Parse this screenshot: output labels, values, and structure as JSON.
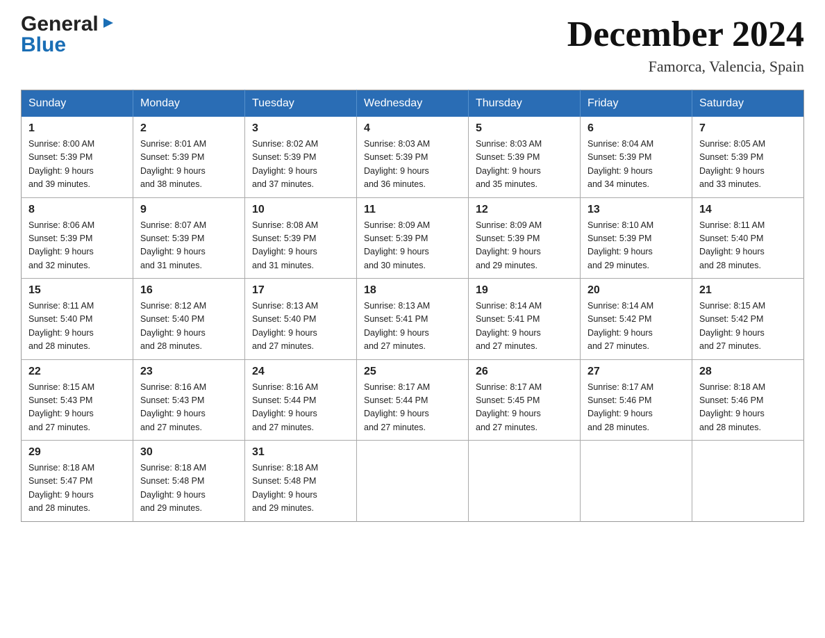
{
  "header": {
    "logo": {
      "general": "General",
      "blue": "Blue"
    },
    "title": "December 2024",
    "location": "Famorca, Valencia, Spain"
  },
  "calendar": {
    "days_of_week": [
      "Sunday",
      "Monday",
      "Tuesday",
      "Wednesday",
      "Thursday",
      "Friday",
      "Saturday"
    ],
    "weeks": [
      [
        {
          "day": 1,
          "sunrise": "8:00 AM",
          "sunset": "5:39 PM",
          "daylight": "9 hours and 39 minutes."
        },
        {
          "day": 2,
          "sunrise": "8:01 AM",
          "sunset": "5:39 PM",
          "daylight": "9 hours and 38 minutes."
        },
        {
          "day": 3,
          "sunrise": "8:02 AM",
          "sunset": "5:39 PM",
          "daylight": "9 hours and 37 minutes."
        },
        {
          "day": 4,
          "sunrise": "8:03 AM",
          "sunset": "5:39 PM",
          "daylight": "9 hours and 36 minutes."
        },
        {
          "day": 5,
          "sunrise": "8:03 AM",
          "sunset": "5:39 PM",
          "daylight": "9 hours and 35 minutes."
        },
        {
          "day": 6,
          "sunrise": "8:04 AM",
          "sunset": "5:39 PM",
          "daylight": "9 hours and 34 minutes."
        },
        {
          "day": 7,
          "sunrise": "8:05 AM",
          "sunset": "5:39 PM",
          "daylight": "9 hours and 33 minutes."
        }
      ],
      [
        {
          "day": 8,
          "sunrise": "8:06 AM",
          "sunset": "5:39 PM",
          "daylight": "9 hours and 32 minutes."
        },
        {
          "day": 9,
          "sunrise": "8:07 AM",
          "sunset": "5:39 PM",
          "daylight": "9 hours and 31 minutes."
        },
        {
          "day": 10,
          "sunrise": "8:08 AM",
          "sunset": "5:39 PM",
          "daylight": "9 hours and 31 minutes."
        },
        {
          "day": 11,
          "sunrise": "8:09 AM",
          "sunset": "5:39 PM",
          "daylight": "9 hours and 30 minutes."
        },
        {
          "day": 12,
          "sunrise": "8:09 AM",
          "sunset": "5:39 PM",
          "daylight": "9 hours and 29 minutes."
        },
        {
          "day": 13,
          "sunrise": "8:10 AM",
          "sunset": "5:39 PM",
          "daylight": "9 hours and 29 minutes."
        },
        {
          "day": 14,
          "sunrise": "8:11 AM",
          "sunset": "5:40 PM",
          "daylight": "9 hours and 28 minutes."
        }
      ],
      [
        {
          "day": 15,
          "sunrise": "8:11 AM",
          "sunset": "5:40 PM",
          "daylight": "9 hours and 28 minutes."
        },
        {
          "day": 16,
          "sunrise": "8:12 AM",
          "sunset": "5:40 PM",
          "daylight": "9 hours and 28 minutes."
        },
        {
          "day": 17,
          "sunrise": "8:13 AM",
          "sunset": "5:40 PM",
          "daylight": "9 hours and 27 minutes."
        },
        {
          "day": 18,
          "sunrise": "8:13 AM",
          "sunset": "5:41 PM",
          "daylight": "9 hours and 27 minutes."
        },
        {
          "day": 19,
          "sunrise": "8:14 AM",
          "sunset": "5:41 PM",
          "daylight": "9 hours and 27 minutes."
        },
        {
          "day": 20,
          "sunrise": "8:14 AM",
          "sunset": "5:42 PM",
          "daylight": "9 hours and 27 minutes."
        },
        {
          "day": 21,
          "sunrise": "8:15 AM",
          "sunset": "5:42 PM",
          "daylight": "9 hours and 27 minutes."
        }
      ],
      [
        {
          "day": 22,
          "sunrise": "8:15 AM",
          "sunset": "5:43 PM",
          "daylight": "9 hours and 27 minutes."
        },
        {
          "day": 23,
          "sunrise": "8:16 AM",
          "sunset": "5:43 PM",
          "daylight": "9 hours and 27 minutes."
        },
        {
          "day": 24,
          "sunrise": "8:16 AM",
          "sunset": "5:44 PM",
          "daylight": "9 hours and 27 minutes."
        },
        {
          "day": 25,
          "sunrise": "8:17 AM",
          "sunset": "5:44 PM",
          "daylight": "9 hours and 27 minutes."
        },
        {
          "day": 26,
          "sunrise": "8:17 AM",
          "sunset": "5:45 PM",
          "daylight": "9 hours and 27 minutes."
        },
        {
          "day": 27,
          "sunrise": "8:17 AM",
          "sunset": "5:46 PM",
          "daylight": "9 hours and 28 minutes."
        },
        {
          "day": 28,
          "sunrise": "8:18 AM",
          "sunset": "5:46 PM",
          "daylight": "9 hours and 28 minutes."
        }
      ],
      [
        {
          "day": 29,
          "sunrise": "8:18 AM",
          "sunset": "5:47 PM",
          "daylight": "9 hours and 28 minutes."
        },
        {
          "day": 30,
          "sunrise": "8:18 AM",
          "sunset": "5:48 PM",
          "daylight": "9 hours and 29 minutes."
        },
        {
          "day": 31,
          "sunrise": "8:18 AM",
          "sunset": "5:48 PM",
          "daylight": "9 hours and 29 minutes."
        },
        null,
        null,
        null,
        null
      ]
    ]
  },
  "labels": {
    "sunrise": "Sunrise:",
    "sunset": "Sunset:",
    "daylight": "Daylight:"
  }
}
